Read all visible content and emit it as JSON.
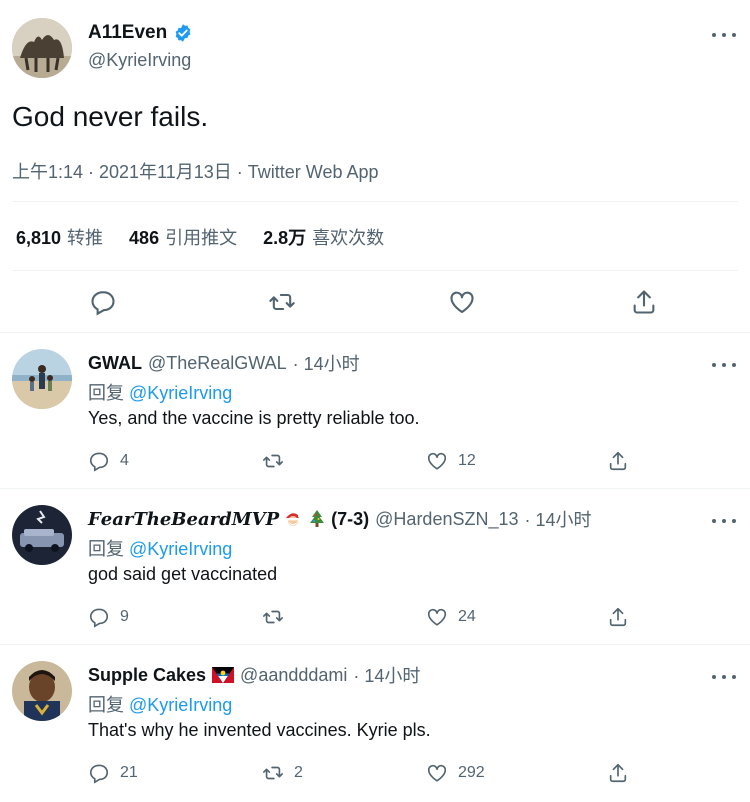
{
  "main_tweet": {
    "author_name": "A11Even",
    "author_handle": "@KyrieIrving",
    "text": "God never fails.",
    "meta": "上午1:14 · 2021年11月13日 · Twitter Web App",
    "stats": [
      {
        "value": "6,810",
        "label": "转推"
      },
      {
        "value": "486",
        "label": "引用推文"
      },
      {
        "value": "2.8万",
        "label": "喜欢次数"
      }
    ],
    "icons": [
      "reply-icon",
      "retweet-icon",
      "like-icon",
      "share-icon"
    ]
  },
  "replies": [
    {
      "name": "GWAL",
      "handle": "@TheRealGWAL",
      "time": "· 14小时",
      "reply_prefix": "回复",
      "reply_to": "@KyrieIrving",
      "text": "Yes, and the vaccine is pretty reliable too.",
      "reply_count": "4",
      "retweet_count": "",
      "like_count": "12"
    },
    {
      "name": "𝑭𝒆𝒂𝒓𝑻𝒉𝒆𝑩𝒆𝒂𝒓𝒅𝑴𝑽𝑷",
      "name_suffix": "(7-3)",
      "handle": "@HardenSZN_13",
      "time": "· 14小时",
      "reply_prefix": "回复",
      "reply_to": "@KyrieIrving",
      "text": "god said get vaccinated",
      "reply_count": "9",
      "retweet_count": "",
      "like_count": "24"
    },
    {
      "name": "Supple Cakes",
      "handle": "@aandddami",
      "time": "· 14小时",
      "reply_prefix": "回复",
      "reply_to": "@KyrieIrving",
      "text": "That's why he invented vaccines. Kyrie pls.",
      "reply_count": "21",
      "retweet_count": "2",
      "like_count": "292"
    }
  ],
  "colors": {
    "text_primary": "#0f1419",
    "text_secondary": "#536471",
    "link": "#1d9bf0",
    "border": "#eff3f4"
  }
}
